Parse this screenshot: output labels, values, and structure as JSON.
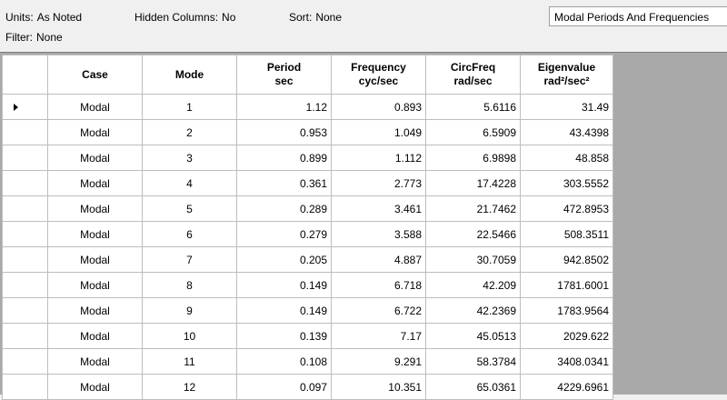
{
  "toolbar": {
    "units_label": "Units:",
    "units_value": "As Noted",
    "hidden_label": "Hidden Columns:",
    "hidden_value": "No",
    "sort_label": "Sort:",
    "sort_value": "None",
    "filter_label": "Filter:",
    "filter_value": "None",
    "table_name": "Modal Periods And Frequencies"
  },
  "columns": [
    {
      "line1": "Case",
      "line2": ""
    },
    {
      "line1": "Mode",
      "line2": ""
    },
    {
      "line1": "Period",
      "line2": "sec"
    },
    {
      "line1": "Frequency",
      "line2": "cyc/sec"
    },
    {
      "line1": "CircFreq",
      "line2": "rad/sec"
    },
    {
      "line1": "Eigenvalue",
      "line2": "rad²/sec²"
    }
  ],
  "rows": [
    {
      "case": "Modal",
      "mode": "1",
      "period": "1.12",
      "frequency": "0.893",
      "circfreq": "5.6116",
      "eigenvalue": "31.49"
    },
    {
      "case": "Modal",
      "mode": "2",
      "period": "0.953",
      "frequency": "1.049",
      "circfreq": "6.5909",
      "eigenvalue": "43.4398"
    },
    {
      "case": "Modal",
      "mode": "3",
      "period": "0.899",
      "frequency": "1.112",
      "circfreq": "6.9898",
      "eigenvalue": "48.858"
    },
    {
      "case": "Modal",
      "mode": "4",
      "period": "0.361",
      "frequency": "2.773",
      "circfreq": "17.4228",
      "eigenvalue": "303.5552"
    },
    {
      "case": "Modal",
      "mode": "5",
      "period": "0.289",
      "frequency": "3.461",
      "circfreq": "21.7462",
      "eigenvalue": "472.8953"
    },
    {
      "case": "Modal",
      "mode": "6",
      "period": "0.279",
      "frequency": "3.588",
      "circfreq": "22.5466",
      "eigenvalue": "508.3511"
    },
    {
      "case": "Modal",
      "mode": "7",
      "period": "0.205",
      "frequency": "4.887",
      "circfreq": "30.7059",
      "eigenvalue": "942.8502"
    },
    {
      "case": "Modal",
      "mode": "8",
      "period": "0.149",
      "frequency": "6.718",
      "circfreq": "42.209",
      "eigenvalue": "1781.6001"
    },
    {
      "case": "Modal",
      "mode": "9",
      "period": "0.149",
      "frequency": "6.722",
      "circfreq": "42.2369",
      "eigenvalue": "1783.9564"
    },
    {
      "case": "Modal",
      "mode": "10",
      "period": "0.139",
      "frequency": "7.17",
      "circfreq": "45.0513",
      "eigenvalue": "2029.622"
    },
    {
      "case": "Modal",
      "mode": "11",
      "period": "0.108",
      "frequency": "9.291",
      "circfreq": "58.3784",
      "eigenvalue": "3408.0341"
    },
    {
      "case": "Modal",
      "mode": "12",
      "period": "0.097",
      "frequency": "10.351",
      "circfreq": "65.0361",
      "eigenvalue": "4229.6961"
    }
  ],
  "current_row_indicator": "right-triangle-icon"
}
